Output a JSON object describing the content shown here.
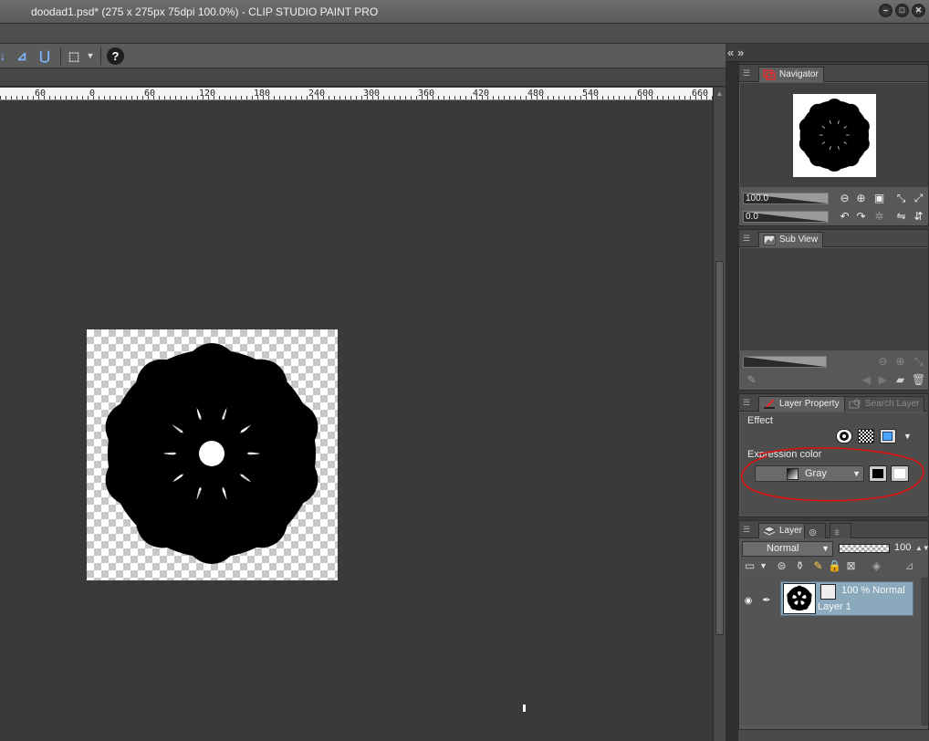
{
  "window": {
    "title": "doodad1.psd* (275 x 275px 75dpi 100.0%)  - CLIP STUDIO PAINT PRO",
    "buttons": [
      "minimize",
      "maximize",
      "close"
    ]
  },
  "toolbar": {
    "help_label": "?"
  },
  "ruler": {
    "labels": [
      "60",
      "0",
      "60",
      "120",
      "180",
      "240",
      "300",
      "360",
      "420",
      "480",
      "540",
      "600",
      "660"
    ]
  },
  "navigator": {
    "tab_label": "Navigator",
    "zoom_value": "100.0",
    "rotation_value": "0.0"
  },
  "sub_view": {
    "tab_label": "Sub View"
  },
  "layer_property": {
    "tab_label": "Layer Property",
    "search_tab_label": "Search Layer",
    "effect_label": "Effect",
    "expression_color_label": "Expression color",
    "expression_color_value": "Gray",
    "accent_color": "#4aa3ff"
  },
  "layer_panel": {
    "tab_label": "Layer",
    "blend_mode": "Normal",
    "opacity": "100",
    "layers": [
      {
        "mode_text": "100 % Normal",
        "name": "Layer 1",
        "selected": true
      }
    ]
  },
  "annotation": {
    "color": "#e01010"
  }
}
